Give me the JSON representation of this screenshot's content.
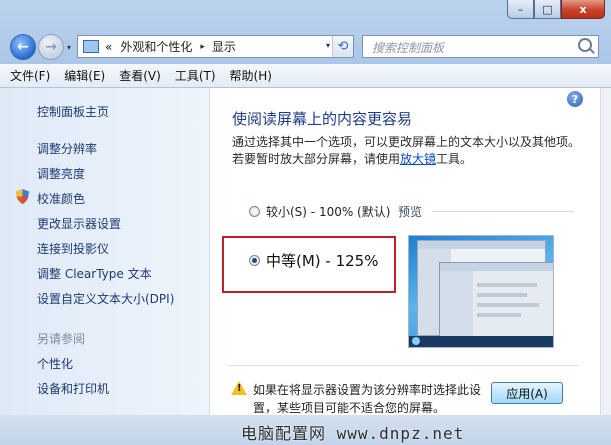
{
  "window": {
    "caption_buttons": {
      "minimize": "–",
      "maximize": "□",
      "close": "x"
    }
  },
  "navigation": {
    "back_icon": "arrow-left-icon",
    "forward_icon": "arrow-right-icon",
    "dropdown_glyph": "▾",
    "breadcrumb": {
      "prefix": "«",
      "segments": [
        "外观和个性化",
        "显示"
      ],
      "separator": "▸"
    },
    "refresh_glyph": "⟲",
    "search_placeholder": "搜索控制面板"
  },
  "menu": {
    "items": [
      "文件(F)",
      "编辑(E)",
      "查看(V)",
      "工具(T)",
      "帮助(H)"
    ]
  },
  "sidebar": {
    "items": [
      {
        "label": "控制面板主页"
      },
      {
        "label": "调整分辨率"
      },
      {
        "label": "调整亮度"
      },
      {
        "label": "校准颜色",
        "icon": "shield-icon"
      },
      {
        "label": "更改显示器设置"
      },
      {
        "label": "连接到投影仪"
      },
      {
        "label": "调整 ClearType 文本"
      },
      {
        "label": "设置自定义文本大小(DPI)"
      }
    ],
    "see_also_heading": "另请参阅",
    "see_also": [
      {
        "label": "个性化"
      },
      {
        "label": "设备和打印机"
      }
    ]
  },
  "main": {
    "help_glyph": "?",
    "title": "使阅读屏幕上的内容更容易",
    "description_part1": "通过选择其中一个选项，可以更改屏幕上的文本大小以及其他项。若要暂时放大部分屏幕，请使用",
    "magnifier_link": "放大镜",
    "description_part2": "工具。",
    "options": [
      {
        "label": "较小(S) - 100% (默认)",
        "selected": false
      },
      {
        "label": "中等(M) - 125%",
        "selected": true
      }
    ],
    "preview_label": "预览",
    "warning_text": "如果在将显示器设置为该分辨率时选择此设置，某些项目可能不适合您的屏幕。",
    "apply_button": "应用(A)"
  },
  "watermark": "电脑配置网 www.dnpz.net",
  "colors": {
    "highlight_box": "#c21e2b",
    "link": "#0a4bc0",
    "title": "#1e3d8a"
  }
}
